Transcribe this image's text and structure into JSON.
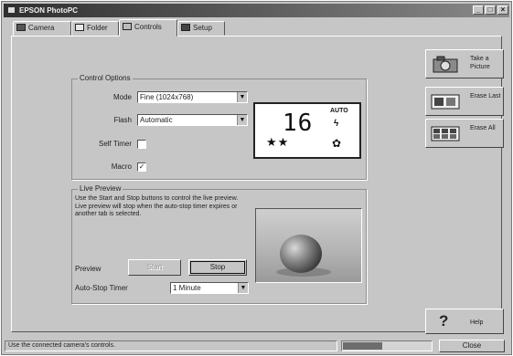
{
  "window": {
    "title": "EPSON PhotoPC",
    "buttons": {
      "minimize": "_",
      "maximize": "□",
      "close": "×"
    }
  },
  "tabs": [
    {
      "label": "Camera",
      "icon": "camera-icon"
    },
    {
      "label": "Folder",
      "icon": "folder-icon"
    },
    {
      "label": "Controls",
      "icon": "controls-icon",
      "active": true
    },
    {
      "label": "Setup",
      "icon": "setup-icon"
    }
  ],
  "control_options": {
    "legend": "Control Options",
    "mode": {
      "label": "Mode",
      "value": "Fine (1024x768)"
    },
    "flash": {
      "label": "Flash",
      "value": "Automatic"
    },
    "self_timer": {
      "label": "Self Timer",
      "checked": false
    },
    "macro": {
      "label": "Macro",
      "checked": true,
      "mark": "✓"
    }
  },
  "lcd": {
    "count": "16",
    "auto": "AUTO",
    "flash_glyph": "ϟ",
    "quality_glyph": "★★",
    "macro_glyph": "✿"
  },
  "live_preview": {
    "legend": "Live Preview",
    "description": "Use the Start and Stop buttons to control the live preview. Live preview will stop when the auto-stop timer expires or another tab is selected.",
    "preview_label": "Preview",
    "start_label": "Start",
    "stop_label": "Stop",
    "auto_stop": {
      "label": "Auto-Stop Timer",
      "value": "1 Minute"
    }
  },
  "side_buttons": {
    "take_picture": "Take a Picture",
    "erase_last": "Erase Last",
    "erase_all": "Erase All",
    "help": "Help"
  },
  "status": {
    "text": "Use the connected camera's controls.",
    "progress": 0.45,
    "close_label": "Close"
  }
}
